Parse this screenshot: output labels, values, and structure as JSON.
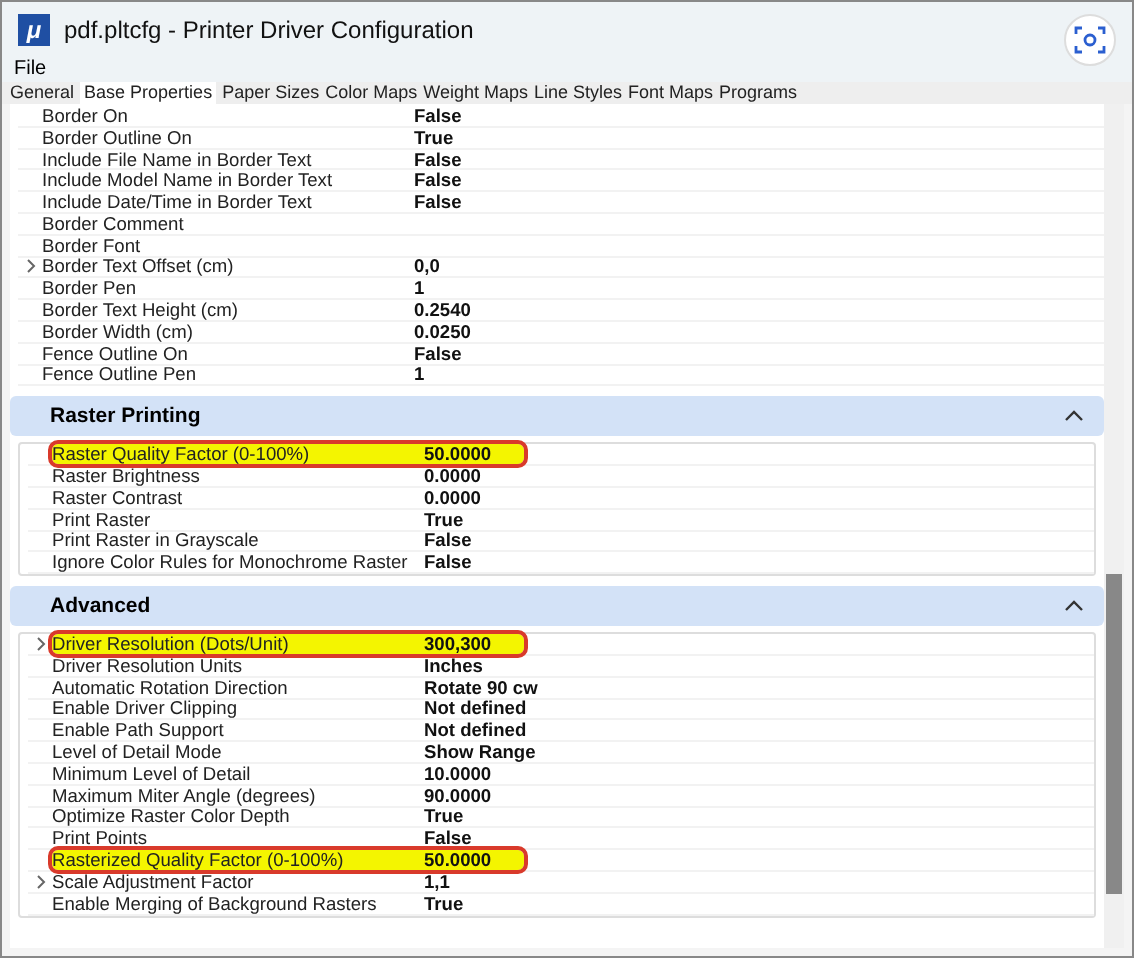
{
  "window": {
    "icon_glyph": "μ",
    "title": "pdf.pltcfg - Printer Driver Configuration"
  },
  "menu": [
    "File"
  ],
  "tabs": [
    {
      "label": "General",
      "selected": false
    },
    {
      "label": "Base Properties",
      "selected": true
    },
    {
      "label": "Paper Sizes",
      "selected": false
    },
    {
      "label": "Color Maps",
      "selected": false
    },
    {
      "label": "Weight Maps",
      "selected": false
    },
    {
      "label": "Line Styles",
      "selected": false
    },
    {
      "label": "Font Maps",
      "selected": false
    },
    {
      "label": "Programs",
      "selected": false
    }
  ],
  "sections": [
    {
      "rows": [
        {
          "name": "Border On",
          "value": "False",
          "expandable": false,
          "highlighted": false
        },
        {
          "name": "Border Outline On",
          "value": "True",
          "expandable": false,
          "highlighted": false
        },
        {
          "name": "Include File Name in Border Text",
          "value": "False",
          "expandable": false,
          "highlighted": false
        },
        {
          "name": "Include Model Name in Border Text",
          "value": "False",
          "expandable": false,
          "highlighted": false
        },
        {
          "name": "Include Date/Time in Border Text",
          "value": "False",
          "expandable": false,
          "highlighted": false
        },
        {
          "name": "Border Comment",
          "value": "",
          "expandable": false,
          "highlighted": false
        },
        {
          "name": "Border Font",
          "value": "",
          "expandable": false,
          "highlighted": false
        },
        {
          "name": "Border Text Offset (cm)",
          "value": "0,0",
          "expandable": true,
          "highlighted": false
        },
        {
          "name": "Border Pen",
          "value": "1",
          "expandable": false,
          "highlighted": false
        },
        {
          "name": "Border Text Height (cm)",
          "value": "0.2540",
          "expandable": false,
          "highlighted": false
        },
        {
          "name": "Border Width (cm)",
          "value": "0.0250",
          "expandable": false,
          "highlighted": false
        },
        {
          "name": "Fence Outline On",
          "value": "False",
          "expandable": false,
          "highlighted": false
        },
        {
          "name": "Fence Outline Pen",
          "value": "1",
          "expandable": false,
          "highlighted": false
        }
      ]
    },
    {
      "header": "Raster Printing",
      "expanded": true,
      "rows": [
        {
          "name": "Raster Quality Factor (0-100%)",
          "value": "50.0000",
          "expandable": false,
          "highlighted": true
        },
        {
          "name": "Raster Brightness",
          "value": "0.0000",
          "expandable": false,
          "highlighted": false
        },
        {
          "name": "Raster Contrast",
          "value": "0.0000",
          "expandable": false,
          "highlighted": false
        },
        {
          "name": "Print Raster",
          "value": "True",
          "expandable": false,
          "highlighted": false
        },
        {
          "name": "Print Raster in Grayscale",
          "value": "False",
          "expandable": false,
          "highlighted": false
        },
        {
          "name": "Ignore Color Rules for Monochrome Raster",
          "value": "False",
          "expandable": false,
          "highlighted": false
        }
      ]
    },
    {
      "header": "Advanced",
      "expanded": true,
      "rows": [
        {
          "name": "Driver Resolution (Dots/Unit)",
          "value": "300,300",
          "expandable": true,
          "highlighted": true
        },
        {
          "name": "Driver Resolution Units",
          "value": "Inches",
          "expandable": false,
          "highlighted": false
        },
        {
          "name": "Automatic Rotation Direction",
          "value": "Rotate 90 cw",
          "expandable": false,
          "highlighted": false
        },
        {
          "name": "Enable Driver Clipping",
          "value": "Not defined",
          "expandable": false,
          "highlighted": false
        },
        {
          "name": "Enable Path Support",
          "value": "Not defined",
          "expandable": false,
          "highlighted": false
        },
        {
          "name": "Level of Detail Mode",
          "value": "Show Range",
          "expandable": false,
          "highlighted": false
        },
        {
          "name": "Minimum Level of Detail",
          "value": "10.0000",
          "expandable": false,
          "highlighted": false
        },
        {
          "name": "Maximum Miter Angle (degrees)",
          "value": "90.0000",
          "expandable": false,
          "highlighted": false
        },
        {
          "name": "Optimize Raster Color Depth",
          "value": "True",
          "expandable": false,
          "highlighted": false
        },
        {
          "name": "Print Points",
          "value": "False",
          "expandable": false,
          "highlighted": false
        },
        {
          "name": "Rasterized Quality Factor (0-100%)",
          "value": "50.0000",
          "expandable": false,
          "highlighted": true
        },
        {
          "name": "Scale Adjustment Factor",
          "value": "1,1",
          "expandable": true,
          "highlighted": false
        },
        {
          "name": "Enable Merging of Background Rasters",
          "value": "True",
          "expandable": false,
          "highlighted": false
        }
      ]
    }
  ]
}
